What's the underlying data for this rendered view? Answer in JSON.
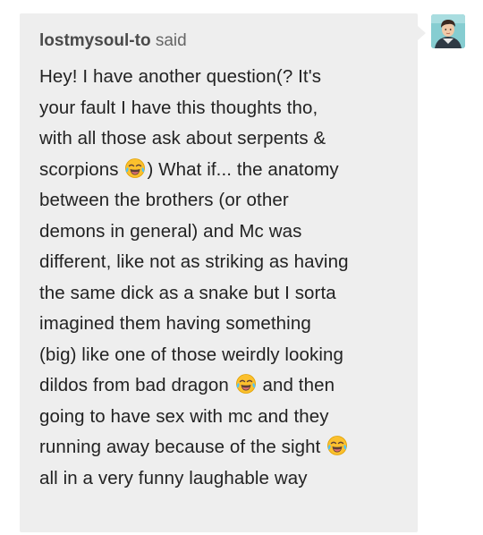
{
  "asker": {
    "username": "lostmysoul-to",
    "said_label": "said",
    "avatar_icon": "user-avatar-icon"
  },
  "ask": {
    "lines": [
      "Hey! I have another question(? It's",
      "your fault I have this thoughts tho,",
      "with all those ask about serpents &",
      "scorpions",
      ") What if... the anatomy",
      "between the brothers (or other",
      "demons in general) and Mc was",
      "different, like not as striking as having",
      "the same dick as a snake but I sorta",
      "imagined them having something",
      "(big) like one of those weirdly looking",
      "dildos from bad dragon",
      "and then",
      "going to have sex with mc and they",
      "running away because of the sight",
      "all in a very funny laughable way"
    ],
    "emoji_icon": "tears-of-joy-emoji-icon"
  },
  "colors": {
    "bubble_background": "#eeeeee",
    "text": "#222222",
    "username": "#4a4a4a"
  }
}
